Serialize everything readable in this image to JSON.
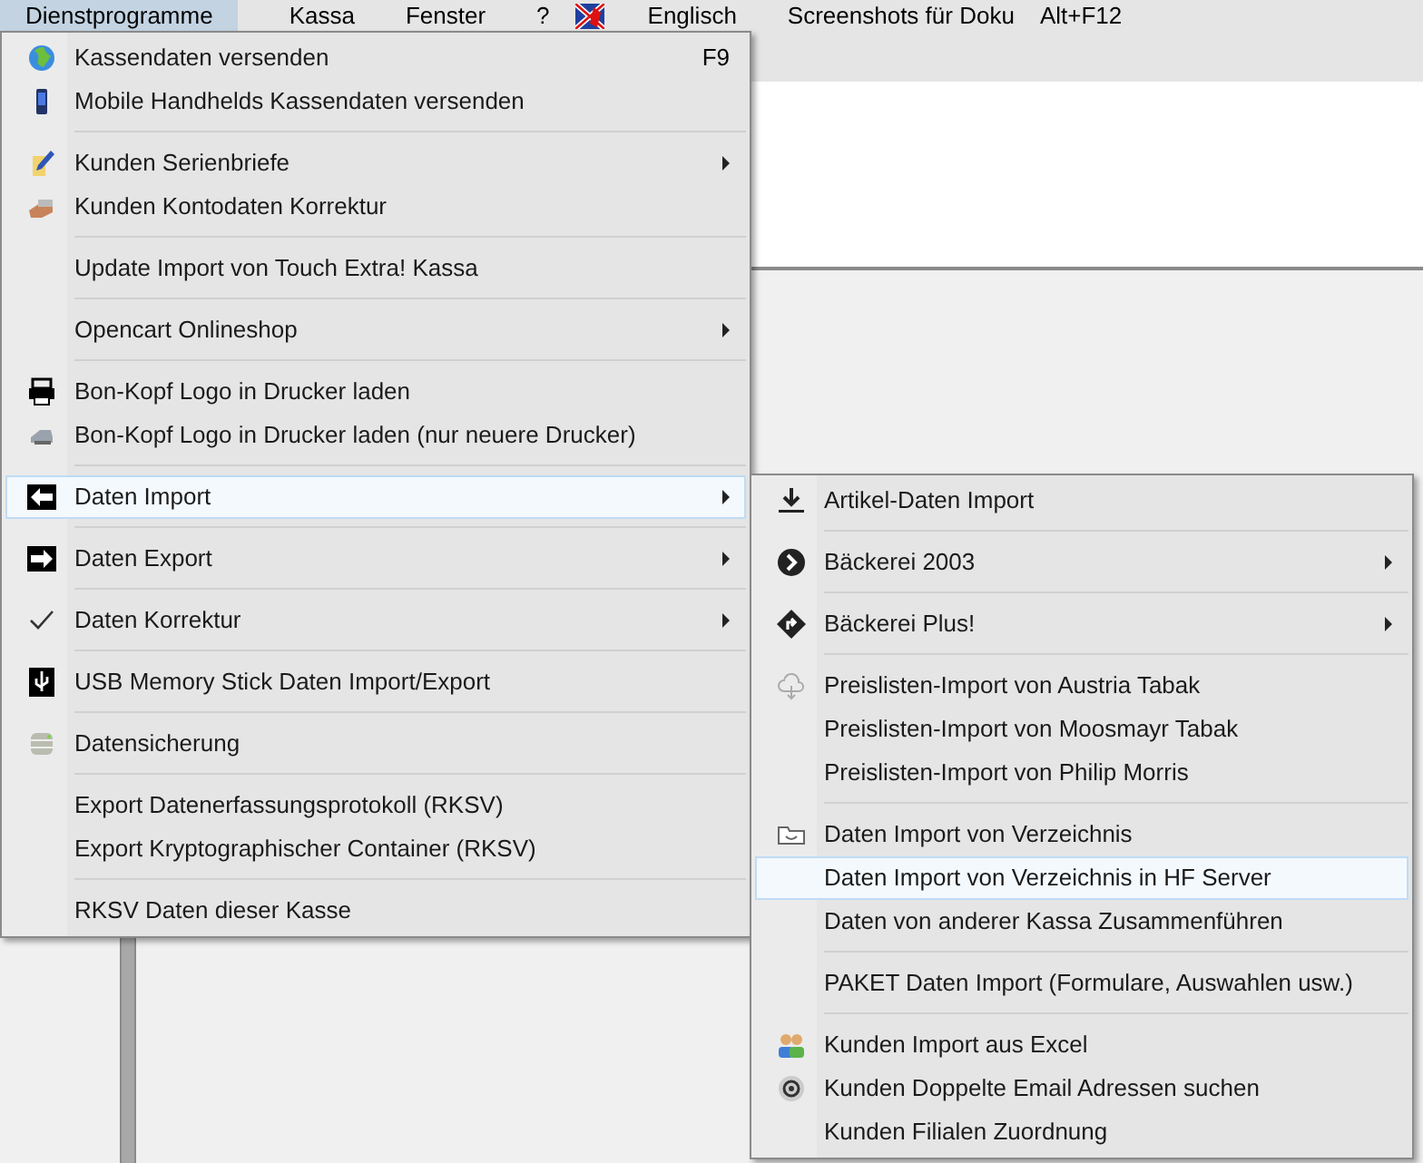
{
  "menubar": [
    {
      "label": "Dienstprogramme",
      "selected": true
    },
    {
      "label": "Kassa",
      "selected": false
    },
    {
      "label": "Fenster",
      "selected": false
    },
    {
      "label": "?",
      "selected": false
    },
    {
      "label": "Englisch",
      "selected": false
    },
    {
      "label": "Screenshots für Doku",
      "selected": false
    },
    {
      "label": "Alt+F12",
      "selected": false
    }
  ],
  "menu": {
    "groups": [
      [
        {
          "label": "Kassendaten versenden",
          "shortcut": "F9",
          "submenu": false,
          "selected": false
        },
        {
          "label": "Mobile Handhelds Kassendaten versenden",
          "submenu": false,
          "selected": false
        }
      ],
      [
        {
          "label": "Kunden Serienbriefe",
          "submenu": true,
          "selected": false
        },
        {
          "label": "Kunden Kontodaten Korrektur",
          "submenu": false,
          "selected": false
        }
      ],
      [
        {
          "label": "Update Import von Touch Extra! Kassa",
          "submenu": false,
          "selected": false
        }
      ],
      [
        {
          "label": "Opencart Onlineshop",
          "submenu": true,
          "selected": false
        }
      ],
      [
        {
          "label": "Bon-Kopf Logo in Drucker laden",
          "submenu": false,
          "selected": false
        },
        {
          "label": "Bon-Kopf Logo in Drucker laden (nur neuere Drucker)",
          "submenu": false,
          "selected": false
        }
      ],
      [
        {
          "label": "Daten Import",
          "submenu": true,
          "selected": true
        }
      ],
      [
        {
          "label": "Daten Export",
          "submenu": true,
          "selected": false
        }
      ],
      [
        {
          "label": "Daten Korrektur",
          "submenu": true,
          "selected": false
        }
      ],
      [
        {
          "label": "USB Memory Stick Daten Import/Export",
          "submenu": false,
          "selected": false
        }
      ],
      [
        {
          "label": "Datensicherung",
          "submenu": false,
          "selected": false
        }
      ],
      [
        {
          "label": "Export Datenerfassungsprotokoll (RKSV)",
          "submenu": false,
          "selected": false
        },
        {
          "label": "Export Kryptographischer Container (RKSV)",
          "submenu": false,
          "selected": false
        }
      ],
      [
        {
          "label": "RKSV Daten dieser Kasse",
          "submenu": false,
          "selected": false
        }
      ]
    ]
  },
  "submenu": {
    "groups": [
      [
        {
          "label": "Artikel-Daten Import",
          "submenu": false,
          "selected": false
        }
      ],
      [
        {
          "label": "Bäckerei 2003",
          "submenu": true,
          "selected": false
        }
      ],
      [
        {
          "label": "Bäckerei Plus!",
          "submenu": true,
          "selected": false
        }
      ],
      [
        {
          "label": "Preislisten-Import von Austria Tabak",
          "submenu": false,
          "selected": false
        },
        {
          "label": "Preislisten-Import von Moosmayr Tabak",
          "submenu": false,
          "selected": false
        },
        {
          "label": "Preislisten-Import von Philip Morris",
          "submenu": false,
          "selected": false
        }
      ],
      [
        {
          "label": "Daten Import von Verzeichnis",
          "submenu": false,
          "selected": false
        },
        {
          "label": "Daten Import von Verzeichnis in HF Server",
          "submenu": false,
          "selected": true
        },
        {
          "label": "Daten von anderer Kassa Zusammenführen",
          "submenu": false,
          "selected": false
        }
      ],
      [
        {
          "label": "PAKET Daten Import (Formulare, Auswahlen usw.)",
          "submenu": false,
          "selected": false
        }
      ],
      [
        {
          "label": "Kunden Import aus Excel",
          "submenu": false,
          "selected": false
        },
        {
          "label": "Kunden Doppelte Email Adressen suchen",
          "submenu": false,
          "selected": false
        },
        {
          "label": "Kunden Filialen Zuordnung",
          "submenu": false,
          "selected": false
        }
      ]
    ]
  }
}
